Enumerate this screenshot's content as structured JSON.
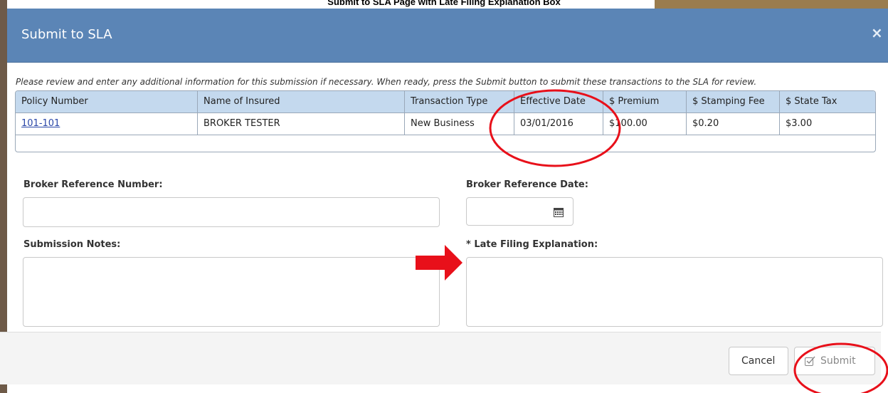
{
  "caption": "Submit to SLA Page with Late Filing Explanation Box",
  "modal": {
    "title": "Submit to SLA",
    "close_label": "×",
    "instructions": "Please review and enter any additional information for this submission if necessary. When ready, press the Submit button to submit these transactions to the SLA for review."
  },
  "table": {
    "headers": [
      "Policy Number",
      "Name of Insured",
      "Transaction Type",
      "Effective Date",
      "$ Premium",
      "$ Stamping Fee",
      "$ State Tax"
    ],
    "rows": [
      [
        "101-101",
        "BROKER TESTER",
        "New Business",
        "03/01/2016",
        "$100.00",
        "$0.20",
        "$3.00"
      ]
    ]
  },
  "form": {
    "broker_ref_number_label": "Broker Reference Number:",
    "broker_ref_number_value": "",
    "broker_ref_date_label": "Broker Reference Date:",
    "broker_ref_date_value": "",
    "submission_notes_label": "Submission Notes:",
    "submission_notes_value": "",
    "late_filing_label": "* Late Filing Explanation:",
    "late_filing_value": ""
  },
  "footer": {
    "cancel_label": "Cancel",
    "submit_label": "Submit"
  },
  "annotations": {
    "highlight_color": "#e8101a"
  },
  "icons": {
    "close": "close-icon",
    "calendar": "calendar-icon",
    "submit": "checkbox-check-icon",
    "arrow": "arrow-right-icon"
  }
}
